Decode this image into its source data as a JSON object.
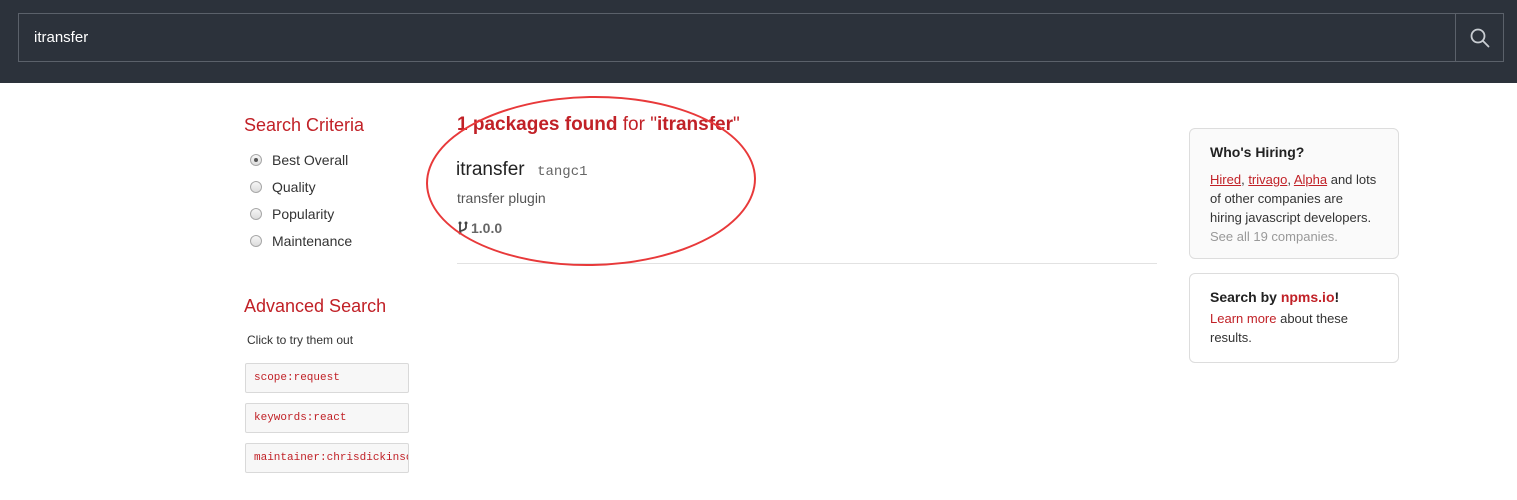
{
  "search": {
    "query": "itransfer",
    "button_icon": "search-icon"
  },
  "sidebar": {
    "criteria_title": "Search Criteria",
    "criteria": [
      {
        "label": "Best Overall",
        "selected": true
      },
      {
        "label": "Quality",
        "selected": false
      },
      {
        "label": "Popularity",
        "selected": false
      },
      {
        "label": "Maintenance",
        "selected": false
      }
    ],
    "advanced_title": "Advanced Search",
    "advanced_hint": "Click to try them out",
    "advanced_examples": [
      "scope:request",
      "keywords:react",
      "maintainer:chrisdickinson"
    ]
  },
  "results": {
    "count_text": "1 packages found",
    "for_text": " for \"",
    "query_text": "itransfer",
    "close_quote": "\"",
    "packages": [
      {
        "name": "itransfer",
        "author": "tangc1",
        "description": "transfer plugin",
        "version": "1.0.0",
        "version_icon": "branch-icon"
      }
    ]
  },
  "hiring_card": {
    "title": "Who's Hiring?",
    "companies": [
      "Hired",
      "trivago",
      "Alpha"
    ],
    "sep1": ", ",
    "sep2": ", ",
    "body": " and lots of other companies are hiring javascript developers.",
    "see_all": "See all 19 companies."
  },
  "npms_card": {
    "title_prefix": "Search by ",
    "title_brand": "npms.io",
    "title_suffix": "!",
    "learn_more": "Learn more",
    "body": " about these results."
  },
  "colors": {
    "topbar": "#2c323b",
    "accent": "#c12127",
    "annotation": "#e8393a"
  }
}
